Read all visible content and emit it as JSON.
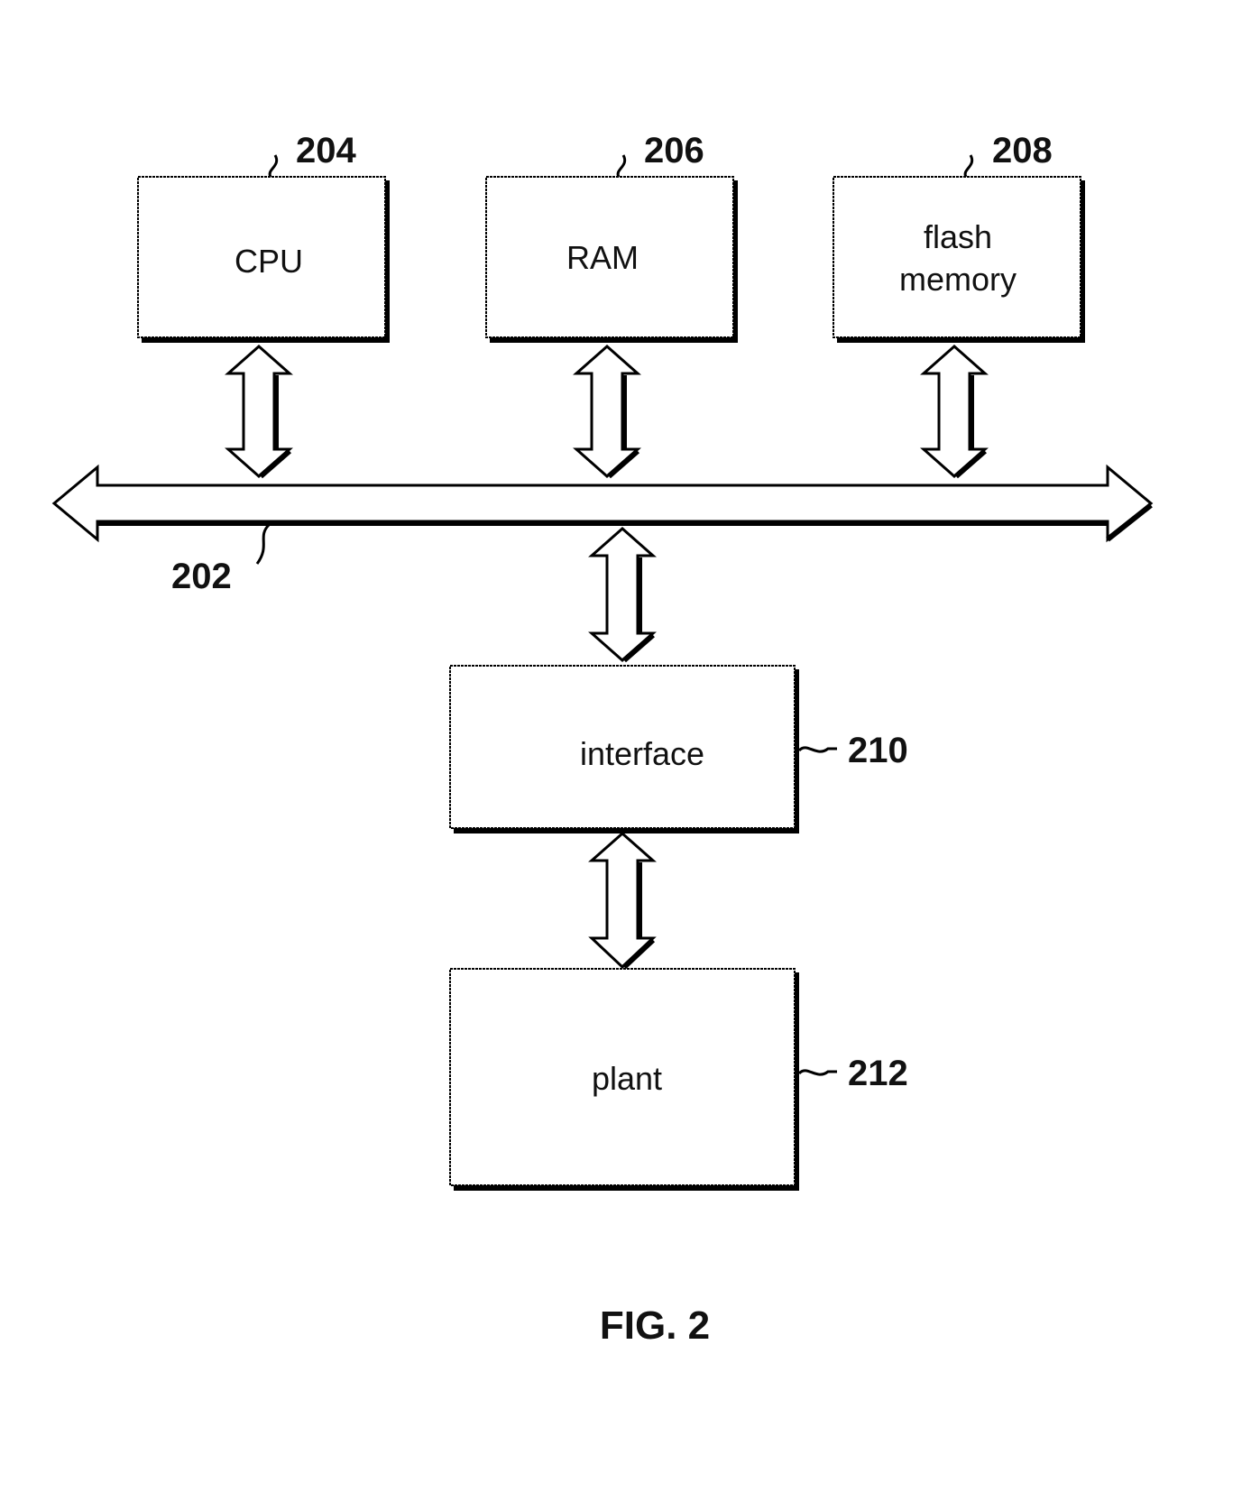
{
  "figure": {
    "caption": "FIG. 2",
    "blocks": {
      "cpu": {
        "label": "CPU",
        "ref": "204"
      },
      "ram": {
        "label": "RAM",
        "ref": "206"
      },
      "flash": {
        "label_line1": "flash",
        "label_line2": "memory",
        "ref": "208"
      },
      "interface": {
        "label": "interface",
        "ref": "210"
      },
      "plant": {
        "label": "plant",
        "ref": "212"
      }
    },
    "bus": {
      "ref": "202"
    }
  }
}
